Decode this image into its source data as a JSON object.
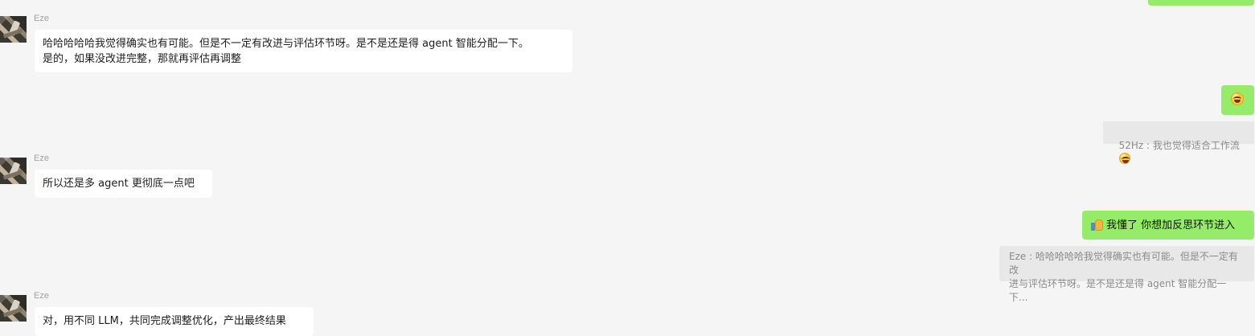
{
  "messages": {
    "m1": {
      "sender": "Eze",
      "text": "哈哈哈哈哈我觉得确实也有可能。但是不一定有改进与评估环节呀。是不是还是得 agent 智能分配一下。\n是的，如果没改进完整，那就再评估再调整"
    },
    "m2": {
      "quote": "52Hz : 我也觉得适合工作流"
    },
    "m3": {
      "sender": "Eze",
      "text": "所以还是多 agent 更彻底一点吧"
    },
    "m4": {
      "text": "我懂了 你想加反思环节进入",
      "quote": "Eze : 哈哈哈哈哈我觉得确实也有可能。但是不一定有改\n进与评估环节呀。是不是还是得 agent 智能分配一下..."
    },
    "m5": {
      "sender": "Eze",
      "text": "对，用不同 LLM，共同完成调整优化，产出最终结果"
    }
  },
  "icons": {
    "avatar": "avatar-photo",
    "emoji_face": "grinning-face-icon",
    "thumbs": "thumbs-up-icon"
  },
  "colors": {
    "background": "#f5f5f5",
    "incoming_bubble": "#ffffff",
    "outgoing_bubble": "#95ec69",
    "quote_bg": "#e8e8e8",
    "name_text": "#a1a1a1"
  }
}
